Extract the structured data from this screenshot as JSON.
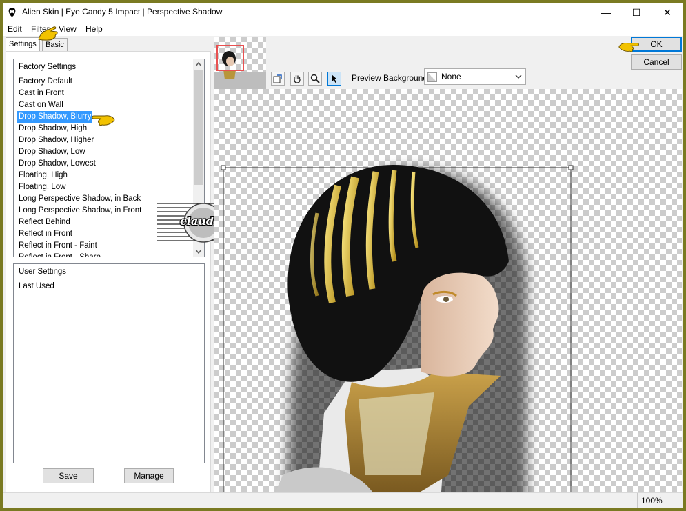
{
  "window": {
    "title": "Alien Skin | Eye Candy 5 Impact | Perspective Shadow",
    "minimize_glyph": "—",
    "maximize_glyph": "☐",
    "close_glyph": "✕"
  },
  "menu": [
    "Edit",
    "Filter",
    "View",
    "Help"
  ],
  "tabs": [
    "Settings",
    "Basic"
  ],
  "factory_settings": {
    "header": "Factory Settings",
    "items": [
      "Factory Default",
      "Cast in Front",
      "Cast on Wall",
      "Drop Shadow, Blurry",
      "Drop Shadow, High",
      "Drop Shadow, Higher",
      "Drop Shadow, Low",
      "Drop Shadow, Lowest",
      "Floating, High",
      "Floating, Low",
      "Long Perspective Shadow, in Back",
      "Long Perspective Shadow, in Front",
      "Reflect Behind",
      "Reflect in Front",
      "Reflect in Front - Faint",
      "Reflect in Front - Sharp"
    ],
    "selected": "Drop Shadow, Blurry"
  },
  "user_settings": {
    "header": "User Settings",
    "items": [
      "Last Used"
    ]
  },
  "buttons": {
    "save": "Save",
    "manage": "Manage",
    "ok": "OK",
    "cancel": "Cancel"
  },
  "preview_background": {
    "label": "Preview Background:",
    "value": "None"
  },
  "watermark": "claudia",
  "status": {
    "zoom": "100%"
  },
  "colors": {
    "selection": "#3399ff",
    "frame": "#7a7a22",
    "pointer": "#f2c200"
  }
}
